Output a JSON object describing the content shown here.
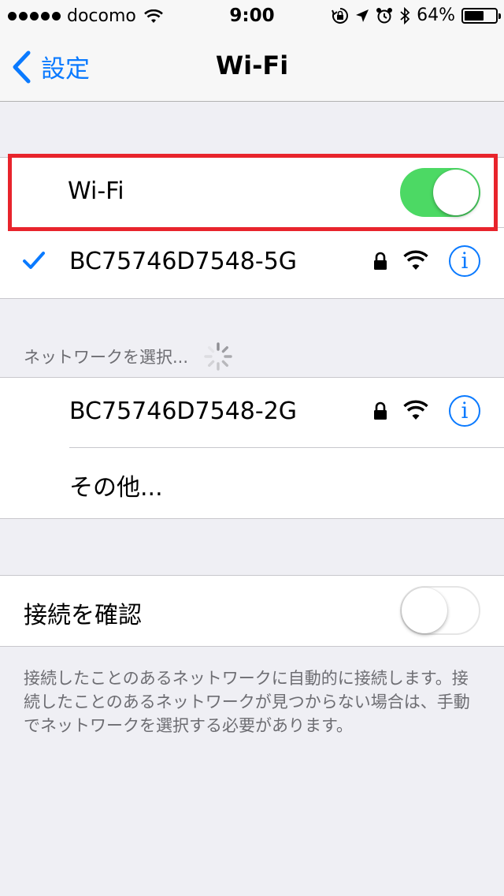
{
  "status_bar": {
    "carrier": "docomo",
    "time": "9:00",
    "battery_percent": "64%",
    "battery_level": 0.64,
    "icons": [
      "signal-dots",
      "wifi-icon",
      "rotation-lock-icon",
      "location-icon",
      "alarm-icon",
      "bluetooth-icon",
      "battery-icon"
    ]
  },
  "nav": {
    "back_label": "設定",
    "title": "Wi-Fi"
  },
  "wifi_toggle": {
    "label": "Wi-Fi",
    "on": true
  },
  "connected_network": {
    "name": "BC75746D7548-5G",
    "secured": true,
    "connected": true
  },
  "choose_network": {
    "header": "ネットワークを選択...",
    "networks": [
      {
        "name": "BC75746D7548-2G",
        "secured": true
      }
    ],
    "other_label": "その他..."
  },
  "ask_to_join": {
    "label": "接続を確認",
    "on": false,
    "footer": "接続したことのあるネットワークに自動的に接続します。接続したことのあるネットワークが見つからない場合は、手動でネットワークを選択する必要があります。"
  },
  "colors": {
    "accent": "#0a7aff",
    "toggle_on": "#4cd964",
    "highlight": "#e8242c",
    "background": "#efeff4"
  }
}
